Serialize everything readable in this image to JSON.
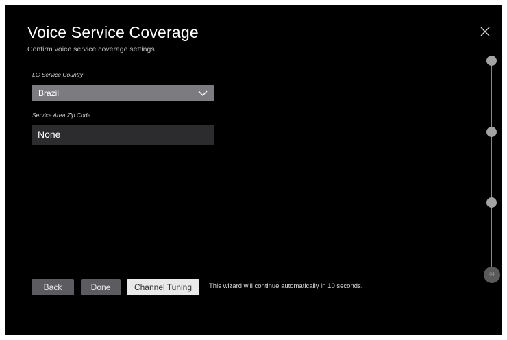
{
  "header": {
    "title": "Voice Service Coverage",
    "subtitle": "Confirm voice service coverage settings."
  },
  "icons": {
    "close": "close-icon",
    "dropdown": "chevron-down-icon"
  },
  "form": {
    "country": {
      "label": "LG Service Country",
      "selected": "Brazil"
    },
    "zip": {
      "label": "Service Area Zip Code",
      "value": "None"
    }
  },
  "buttons": {
    "back": "Back",
    "done": "Done",
    "channel_tuning": "Channel Tuning"
  },
  "auto_message": "This wizard will continue automatically in 10 seconds.",
  "steps": {
    "current_label": "04"
  },
  "colors": {
    "background": "#000000",
    "dropdown": "#7b7b80",
    "input": "#2c2c2e",
    "button": "#5c5c60",
    "button_primary": "#e9e9e9"
  }
}
